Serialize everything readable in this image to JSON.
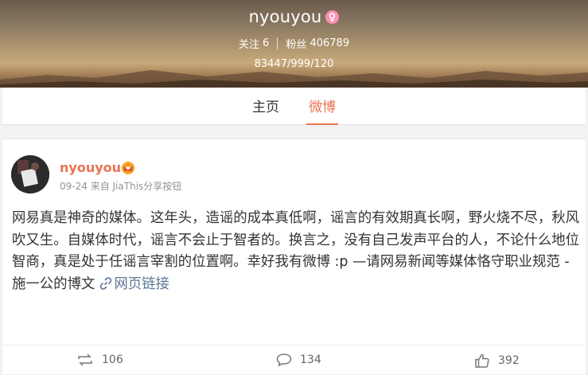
{
  "profile": {
    "name": "nyouyou",
    "following_label": "关注",
    "following_count": "6",
    "followers_label": "粉丝",
    "followers_count": "406789",
    "counts": "83447/999/120"
  },
  "tabs": [
    {
      "label": "主页"
    },
    {
      "label": "微博"
    }
  ],
  "post": {
    "author": "nyouyou",
    "date": "09-24",
    "source_prefix": "来自",
    "source": "JiaThis分享按钮",
    "text": "网易真是神奇的媒体。这年头，造谣的成本真低啊，谣言的有效期真长啊，野火烧不尽，秋风吹又生。自媒体时代，谣言不会止于智者的。换言之，没有自己发声平台的人，不论什么地位智商，真是处于任谣言宰割的位置啊。幸好我有微博 :p —请网易新闻等媒体恪守职业规范 - 施一公的博文",
    "link_label": "网页链接",
    "reposts": "106",
    "comments": "134",
    "likes": "392"
  },
  "colors": {
    "accent": "#eb7350",
    "link": "#5d7895"
  },
  "icons": {
    "gender": "female-icon",
    "vip": "vip-crown-icon",
    "repost": "repost-icon",
    "comment": "comment-icon",
    "like": "thumbs-up-icon",
    "link": "link-icon"
  }
}
